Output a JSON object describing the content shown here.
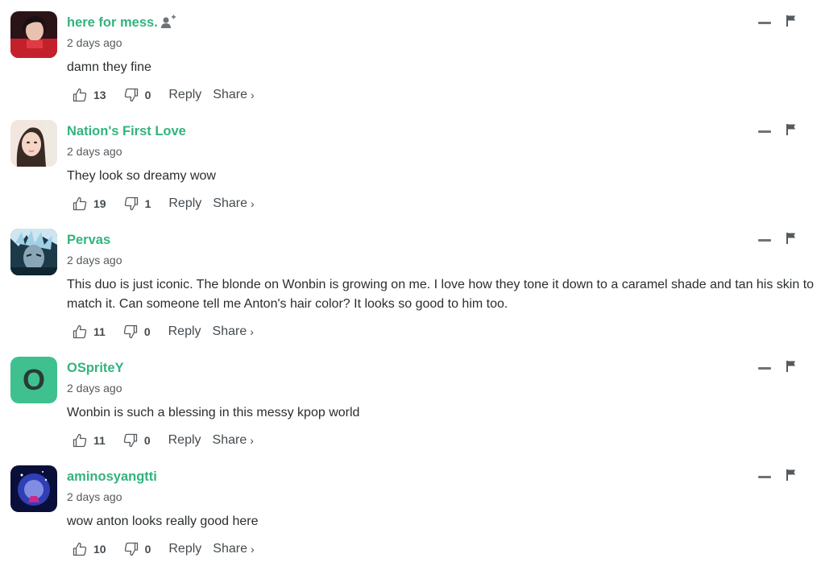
{
  "comments": [
    {
      "author": "here for mess.",
      "time": "2 days ago",
      "text": "damn they fine",
      "likes": "13",
      "dislikes": "0",
      "reply_label": "Reply",
      "share_label": "Share",
      "share_chevron": "›",
      "avatar": "photo",
      "follow_icon": "add-user-icon"
    },
    {
      "author": "Nation's First Love",
      "time": "2 days ago",
      "text": "They look so dreamy wow",
      "likes": "19",
      "dislikes": "1",
      "reply_label": "Reply",
      "share_label": "Share",
      "share_chevron": "›",
      "avatar": "photo"
    },
    {
      "author": "Pervas",
      "time": "2 days ago",
      "text": "This duo is just iconic. The blonde on Wonbin is growing on me. I love how they tone it down to a caramel shade and tan his skin to match it. Can someone tell me Anton's hair color? It looks so good to him too.",
      "likes": "11",
      "dislikes": "0",
      "reply_label": "Reply",
      "share_label": "Share",
      "share_chevron": "›",
      "avatar": "photo"
    },
    {
      "author": "OSpriteY",
      "time": "2 days ago",
      "text": "Wonbin is such a blessing in this messy kpop world",
      "likes": "11",
      "dislikes": "0",
      "reply_label": "Reply",
      "share_label": "Share",
      "share_chevron": "›",
      "avatar": "letter",
      "avatar_letter": "O"
    },
    {
      "author": "aminosyangtti",
      "time": "2 days ago",
      "text": "wow anton looks really good here",
      "likes": "10",
      "dislikes": "0",
      "reply_label": "Reply",
      "share_label": "Share",
      "share_chevron": "›",
      "avatar": "photo"
    }
  ],
  "colors": {
    "author": "#32b37e",
    "letter_avatar_bg": "#3fc08f",
    "text": "#2a2e2e",
    "muted": "#555a5e"
  },
  "icons": {
    "like": "thumbs-up-icon",
    "dislike": "thumbs-down-icon",
    "collapse": "minus-icon",
    "flag": "flag-icon"
  }
}
